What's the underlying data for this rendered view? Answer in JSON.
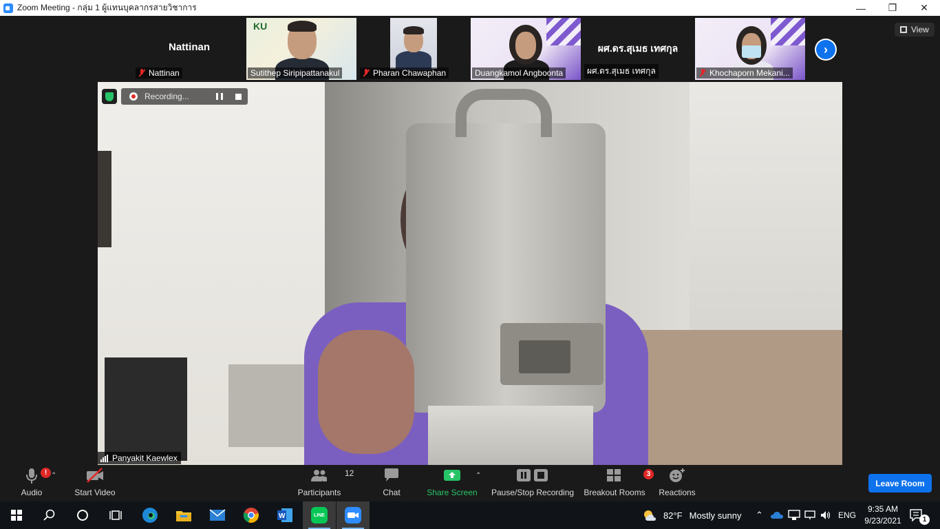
{
  "window": {
    "title": "Zoom Meeting - กลุ่ม 1 ผู้แทนบุคลากรสายวิชาการ",
    "minimize": "—",
    "restore": "❐",
    "close": "✕"
  },
  "gallery": {
    "view_label": "View",
    "participants": [
      {
        "label": "Nattinan",
        "display": "Nattinan",
        "muted": true,
        "video": false
      },
      {
        "label": "Sutithep Siripipattanakul",
        "muted": false,
        "video": true,
        "logo_text": "KU"
      },
      {
        "label": "Pharan Chawaphan",
        "muted": true,
        "video": true
      },
      {
        "label": "Duangkamol Angboonta",
        "muted": false,
        "video": true
      },
      {
        "label": "ผศ.ดร.สุเมธ เทศกุล",
        "display": "ผศ.ดร.สุเมธ เทศกุล",
        "muted": false,
        "video": false
      },
      {
        "label": "Khochaporn Mekani...",
        "muted": true,
        "video": true
      }
    ]
  },
  "main": {
    "recording_text": "Recording...",
    "speaker_name": "Panyakit Kaewlex"
  },
  "toolbar": {
    "audio": "Audio",
    "start_video": "Start Video",
    "participants": "Participants",
    "participants_count": "12",
    "chat": "Chat",
    "share_screen": "Share Screen",
    "pause_stop_recording": "Pause/Stop Recording",
    "breakout_rooms": "Breakout Rooms",
    "breakout_badge": "3",
    "reactions": "Reactions",
    "leave_room": "Leave Room",
    "audio_alert": "!"
  },
  "taskbar": {
    "weather_temp": "82°F",
    "weather_text": "Mostly sunny",
    "language": "ENG",
    "time": "9:35 AM",
    "date": "9/23/2021",
    "notifications_count": "1",
    "line_app_text": "LINE"
  },
  "colors": {
    "accent": "#0e72ed",
    "muted_red": "#e02828",
    "share_green": "#27c467",
    "toolbar_bg": "#1a1a1a"
  }
}
